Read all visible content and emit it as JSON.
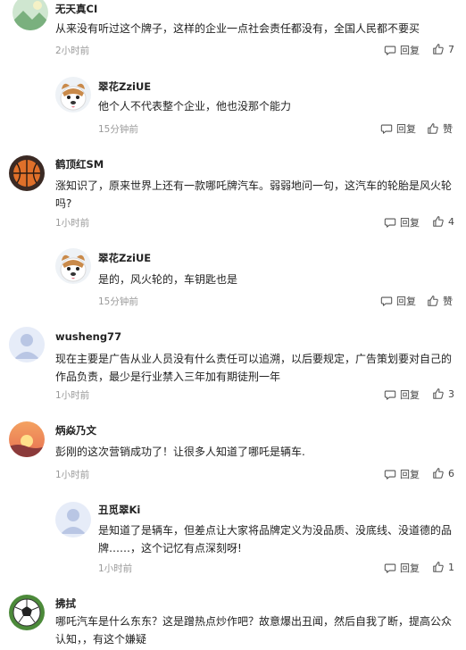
{
  "actions": {
    "reply_label": "回复",
    "like_label": "赞"
  },
  "comments": [
    {
      "user": "无天真CI",
      "text": "从来没有听过这个牌子，这样的企业一点社会责任都没有，全国人民都不要买",
      "time": "2小时前",
      "likes": "7",
      "replies": [
        {
          "user": "翠花ZziUE",
          "text": "他个人不代表整个企业，他也没那个能力",
          "time": "15分钟前"
        }
      ]
    },
    {
      "user": "鹤顶红SM",
      "text": "涨知识了，原来世界上还有一款哪吒牌汽车。弱弱地问一句，这汽车的轮胎是风火轮吗?",
      "time": "1小时前",
      "likes": "4",
      "replies": [
        {
          "user": "翠花ZziUE",
          "text": "是的，风火轮的，车钥匙也是",
          "time": "15分钟前"
        }
      ]
    },
    {
      "user": "wusheng77",
      "text": "现在主要是广告从业人员没有什么责任可以追溯，以后要规定，广告策划要对自己的作品负责，最少是行业禁入三年加有期徒刑一年",
      "time": "1小时前",
      "likes": "3",
      "replies": []
    },
    {
      "user": "炳焱乃文",
      "text": "彭刚的这次营销成功了！让很多人知道了哪吒是辆车.",
      "time": "1小时前",
      "likes": "6",
      "replies": [
        {
          "user": "丑觅翠Ki",
          "text": "是知道了是辆车，但差点让大家将品牌定义为没品质、没底线、没道德的品牌……，这个记忆有点深刻呀!",
          "time": "1小时前",
          "likes": "1"
        }
      ]
    },
    {
      "user": "拂拭",
      "text": "哪吒汽车是什么东东？这是蹭热点炒作吧？故意爆出丑闻，然后自我了断，提高公众认知，，有这个嫌疑",
      "time": "",
      "likes": "",
      "replies": []
    }
  ],
  "avatar_icons": [
    "landscape-avatar-icon",
    "dog-avatar-icon",
    "basketball-avatar-icon",
    "default-user-avatar-icon",
    "sunset-avatar-icon",
    "soccer-ball-avatar-icon"
  ],
  "colors": {
    "time": "#9a9a9a",
    "text": "#222222",
    "action": "#444444"
  }
}
